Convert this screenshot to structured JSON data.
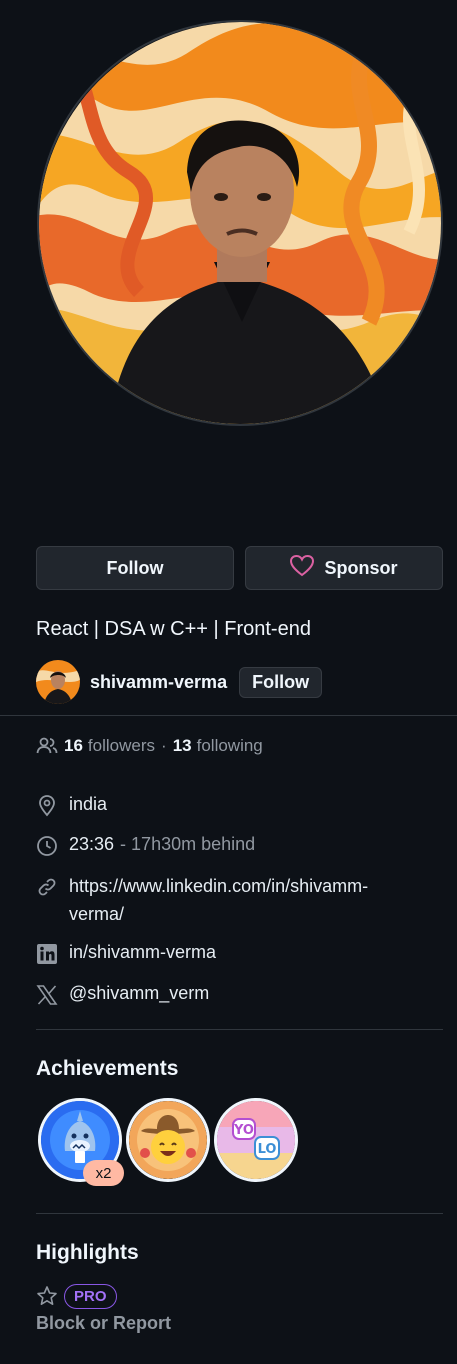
{
  "profile": {
    "follow_label": "Follow",
    "sponsor_label": "Sponsor",
    "bio": "React | DSA w C++ | Front-end",
    "org": {
      "name": "shivamm-verma",
      "follow_label": "Follow"
    },
    "followers_count": "16",
    "followers_label": "followers",
    "following_count": "13",
    "following_label": "following",
    "separator": "·"
  },
  "details": {
    "location": "india",
    "time": "23:36",
    "time_offset": "- 17h30m behind",
    "website": "https://www.linkedin.com/in/shivamm-verma/",
    "linkedin": "in/shivamm-verma",
    "x_handle": "@shivamm_verm"
  },
  "achievements": {
    "title": "Achievements",
    "badges": [
      {
        "name": "shark-badge",
        "count": "x2"
      },
      {
        "name": "cowboy-badge"
      },
      {
        "name": "yolo-badge"
      }
    ]
  },
  "highlights": {
    "title": "Highlights",
    "pro_label": "PRO",
    "block_label": "Block or Report"
  },
  "colors": {
    "background": "#0d1117",
    "button_bg": "#21262d",
    "muted_text": "#9198a1",
    "pro_purple": "#a371f7",
    "sponsor_heart": "#db61a2"
  }
}
